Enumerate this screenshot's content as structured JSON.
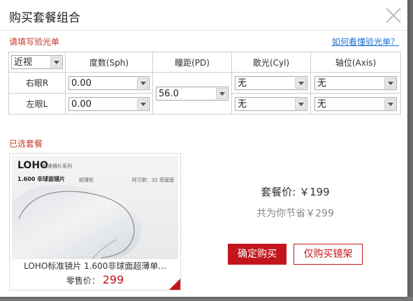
{
  "dialog": {
    "title": "购买套餐组合",
    "rx_section_label": "请填写验光单",
    "help_link": "如何看懂验光单？",
    "package_section_label": "已选套餐"
  },
  "rx_table": {
    "vision_type": "近视",
    "headers": [
      "度数(Sph)",
      "瞳距(PD)",
      "散光(Cyl)",
      "轴位(Axis)"
    ],
    "right_eye": {
      "label": "右眼R",
      "sph": "0.00",
      "cyl": "无",
      "axis": "无"
    },
    "left_eye": {
      "label": "左眼L",
      "sph": "0.00",
      "cyl": "无",
      "axis": "无"
    },
    "pd": "56.0"
  },
  "product": {
    "brand": "LOHO",
    "brand_series": "标准镜片系列",
    "image_line": "1.600 非球面镜片",
    "image_tag": "超薄型",
    "image_right": "阿贝数：32  菲膜膜",
    "name": "LOHO标准镜片 1.600非球面超薄单...",
    "retail_label": "零售价：",
    "retail_price": "299"
  },
  "summary": {
    "package_price": "套餐价: ￥199",
    "savings": "共为你节省￥299"
  },
  "buttons": {
    "confirm": "确定购买",
    "frame_only": "仅购买镜架"
  },
  "colors": {
    "accent": "#c3161c",
    "link": "#1a6fd6"
  }
}
